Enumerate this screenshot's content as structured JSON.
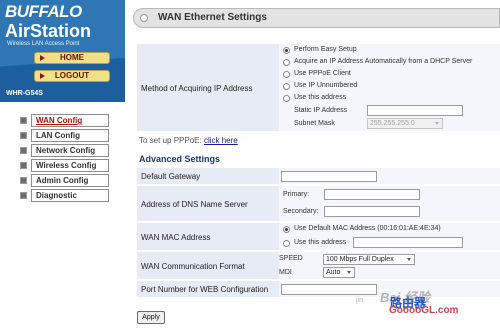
{
  "brand": {
    "logo_text": "BUFFALO",
    "product_name": "AirStation",
    "tagline": "Wireless LAN Access Point",
    "model": "WHR-G54S",
    "colors": {
      "header_blue": "#2f77b4",
      "button_yellow": "#f1e088",
      "active_red": "#b01010"
    }
  },
  "top_nav": {
    "home_label": "HOME",
    "logout_label": "LOGOUT"
  },
  "sidebar": {
    "items": [
      {
        "label": "WAN Config",
        "active": true
      },
      {
        "label": "LAN Config",
        "active": false
      },
      {
        "label": "Network Config",
        "active": false
      },
      {
        "label": "Wireless Config",
        "active": false
      },
      {
        "label": "Admin Config",
        "active": false
      },
      {
        "label": "Diagnostic",
        "active": false
      }
    ]
  },
  "page": {
    "title": "WAN Ethernet Settings"
  },
  "ip_method": {
    "label": "Method of Acquiring IP Address",
    "options": [
      {
        "label": "Perform Easy Setup",
        "checked": true
      },
      {
        "label": "Acquire an IP Address Automatically from a DHCP Server",
        "checked": false
      },
      {
        "label": "Use PPPoE Client",
        "checked": false
      },
      {
        "label": "Use IP Unnumbered",
        "checked": false
      },
      {
        "label": "Use this address",
        "checked": false
      }
    ],
    "static_ip_label": "Static IP Address",
    "static_ip_value": "",
    "subnet_mask_label": "Subnet Mask",
    "subnet_mask_value": "255.255.255.0"
  },
  "pppoe_note": {
    "text": "To set up PPPoE:",
    "link": "click here"
  },
  "advanced": {
    "heading": "Advanced Settings",
    "default_gateway": {
      "label": "Default Gateway",
      "value": ""
    },
    "dns": {
      "label": "Address of DNS Name Server",
      "primary_label": "Primary:",
      "primary_value": "",
      "secondary_label": "Secondary:",
      "secondary_value": ""
    },
    "wan_mac": {
      "label": "WAN MAC Address",
      "default_option": "Use Default MAC Address (00:16:01:AE:4E:34)",
      "custom_option": "Use this address",
      "custom_value": ""
    },
    "comm_format": {
      "label": "WAN Communication Format",
      "speed_label": "SPEED",
      "speed_value": "100 Mbps Full Duplex",
      "mdi_label": "MDI",
      "mdi_value": "Auto"
    },
    "web_port": {
      "label": "Port Number for WEB Configuration",
      "value": ""
    }
  },
  "apply_label": "Apply",
  "watermark": {
    "main": "Bai 经验",
    "site": "路由器",
    "url": "GooooGL.com",
    "prefix": "jin"
  }
}
